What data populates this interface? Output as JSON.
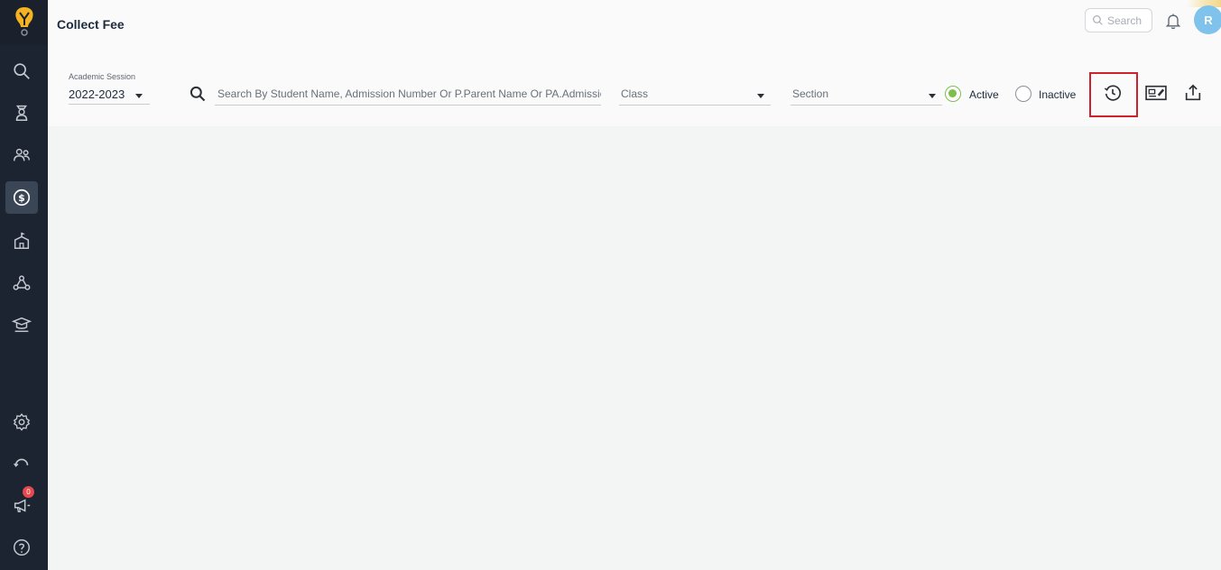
{
  "header": {
    "title": "Collect Fee",
    "search_placeholder": "Search",
    "avatar_initial": "R"
  },
  "filters": {
    "session_label": "Academic Session",
    "session_value": "2022-2023",
    "search_placeholder": "Search By Student Name, Admission Number Or P.Parent Name Or PA.Admission I",
    "class_placeholder": "Class",
    "section_placeholder": "Section",
    "status_options": [
      {
        "label": "Active",
        "selected": true
      },
      {
        "label": "Inactive",
        "selected": false
      }
    ]
  },
  "sidebar": {
    "items": [
      {
        "icon": "search-icon"
      },
      {
        "icon": "student-icon"
      },
      {
        "icon": "users-icon"
      },
      {
        "icon": "fee-dollar-icon",
        "active": true
      },
      {
        "icon": "school-icon"
      },
      {
        "icon": "network-icon"
      },
      {
        "icon": "graduation-icon"
      },
      {
        "icon": "settings-icon"
      },
      {
        "icon": "refresh-icon"
      },
      {
        "icon": "announcement-icon",
        "badge": "0"
      },
      {
        "icon": "help-icon"
      }
    ]
  },
  "toolbar": {
    "tools": [
      "history-icon",
      "id-card-icon",
      "export-icon"
    ]
  },
  "colors": {
    "sidebar_bg": "#1c2431",
    "accent_green": "#7cc04b",
    "avatar_bg": "#7fc3ec",
    "highlight_red": "#d0202b"
  }
}
